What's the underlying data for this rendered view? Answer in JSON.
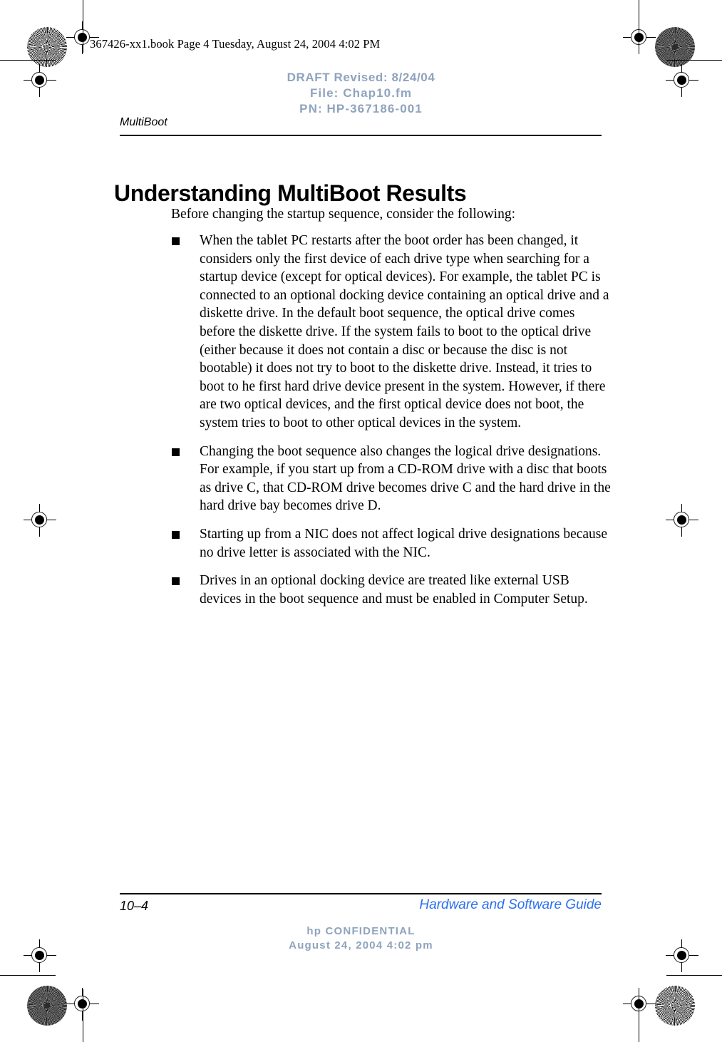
{
  "scan_header": {
    "text": "367426-xx1.book  Page 4  Tuesday, August 24, 2004  4:02 PM"
  },
  "draft_stamp": {
    "revised": "DRAFT Revised: 8/24/04",
    "file": "File: Chap10.fm",
    "part_number": "PN: HP-367186-001",
    "color": "#8fa3bd"
  },
  "running_head": {
    "chapter": "MultiBoot"
  },
  "page": {
    "title": "Understanding MultiBoot Results",
    "intro": "Before changing the startup sequence, consider the following:",
    "bullets": [
      "When the tablet PC restarts after the boot order has been changed, it considers only the first device of each drive type when searching for a startup device (except for optical devices). For example, the tablet PC is connected to an optional docking device containing an optical drive and a diskette drive. In the default boot sequence, the optical drive comes before the diskette drive. If the system fails to boot to the optical drive (either because it does not contain a disc or because the disc is not bootable) it does not try to boot to the diskette drive. Instead, it tries to boot to he first hard drive device present in the system. However, if there are two optical devices, and the first optical device does not boot, the system tries to boot to other optical devices in the system.",
      "Changing the boot sequence also changes the logical drive designations. For example, if you start up from a CD-ROM drive with a disc that boots as drive C, that CD-ROM drive becomes drive C and the hard drive in the hard drive bay becomes drive D.",
      "Starting up from a NIC does not affect logical drive designations because no drive letter is associated with the NIC.",
      "Drives in an optional docking device are treated like external USB devices in the boot sequence and must be enabled in Computer Setup."
    ]
  },
  "footer": {
    "folio": "10–4",
    "guide": "Hardware and Software Guide",
    "guide_color": "#2a6ff0",
    "confidential_line1": "hp CONFIDENTIAL",
    "confidential_line2": "August 24, 2004 4:02 pm"
  }
}
